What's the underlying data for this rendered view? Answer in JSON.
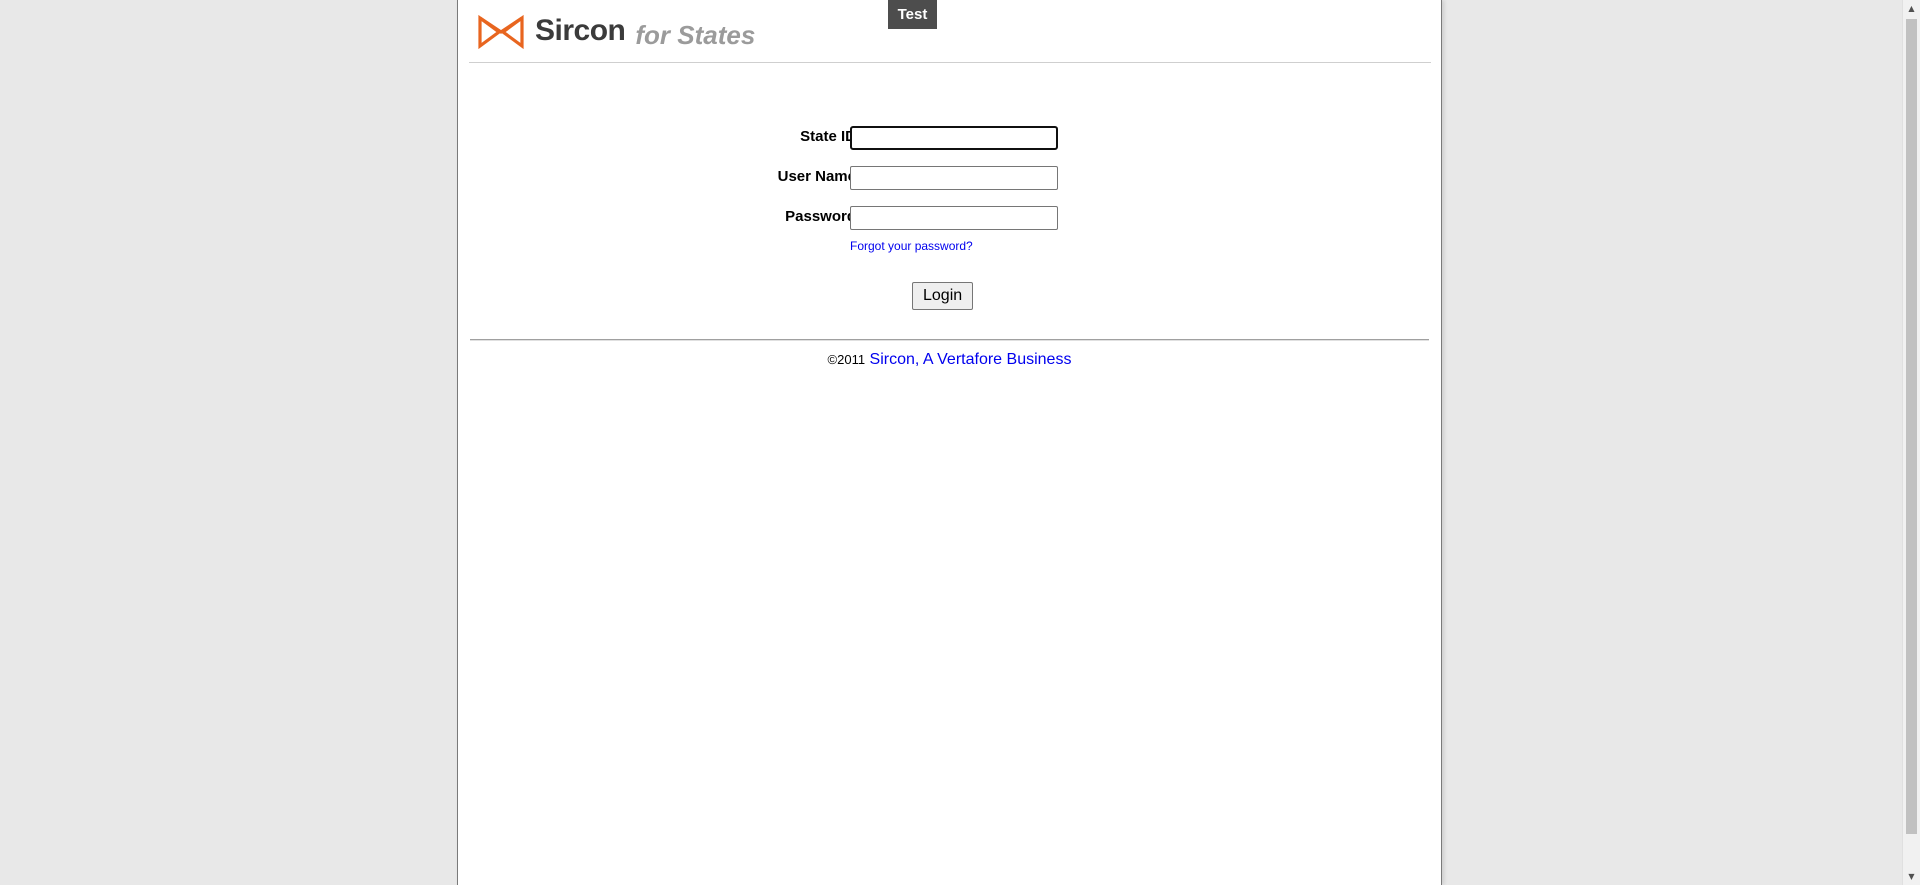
{
  "environment_badge": "Test",
  "header": {
    "logo_icon": "sircon-bowtie-logo-icon",
    "brand_name": "Sircon",
    "brand_suffix": "for States",
    "logo_color": "#e8651f"
  },
  "login_form": {
    "state_id_label": "State ID",
    "state_id_value": "",
    "username_label": "User Name",
    "username_value": "",
    "password_label": "Password",
    "password_value": "",
    "forgot_link": "Forgot your password?",
    "login_button": "Login"
  },
  "footer": {
    "copyright": "©2011",
    "company_link": "Sircon, A Vertafore Business"
  },
  "colors": {
    "background": "#e8e8e8",
    "link": "#0000ee",
    "badge": "#4d4d4d"
  }
}
